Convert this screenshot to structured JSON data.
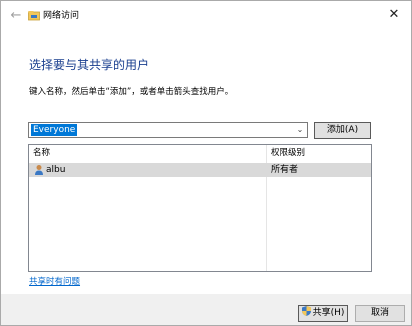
{
  "window": {
    "title": "网络访问",
    "back_icon": "arrow-left-icon",
    "close_icon": "close-icon"
  },
  "main": {
    "heading": "选择要与其共享的用户",
    "instruction": "键入名称，然后单击“添加”，或者单击箭头查找用户。",
    "combo_value": "Everyone",
    "add_button": "添加(A)"
  },
  "table": {
    "headers": [
      "名称",
      "权限级别"
    ],
    "rows": [
      {
        "name": "albu",
        "permission": "所有者",
        "icon": "user-icon"
      }
    ]
  },
  "help_link": "共享时有问题",
  "footer": {
    "share_button": "共享(H)",
    "cancel_button": "取消"
  },
  "colors": {
    "heading": "#1a3f8f",
    "selection": "#0078d7",
    "link": "#0066cc",
    "row_highlight": "#d9d9d9"
  }
}
